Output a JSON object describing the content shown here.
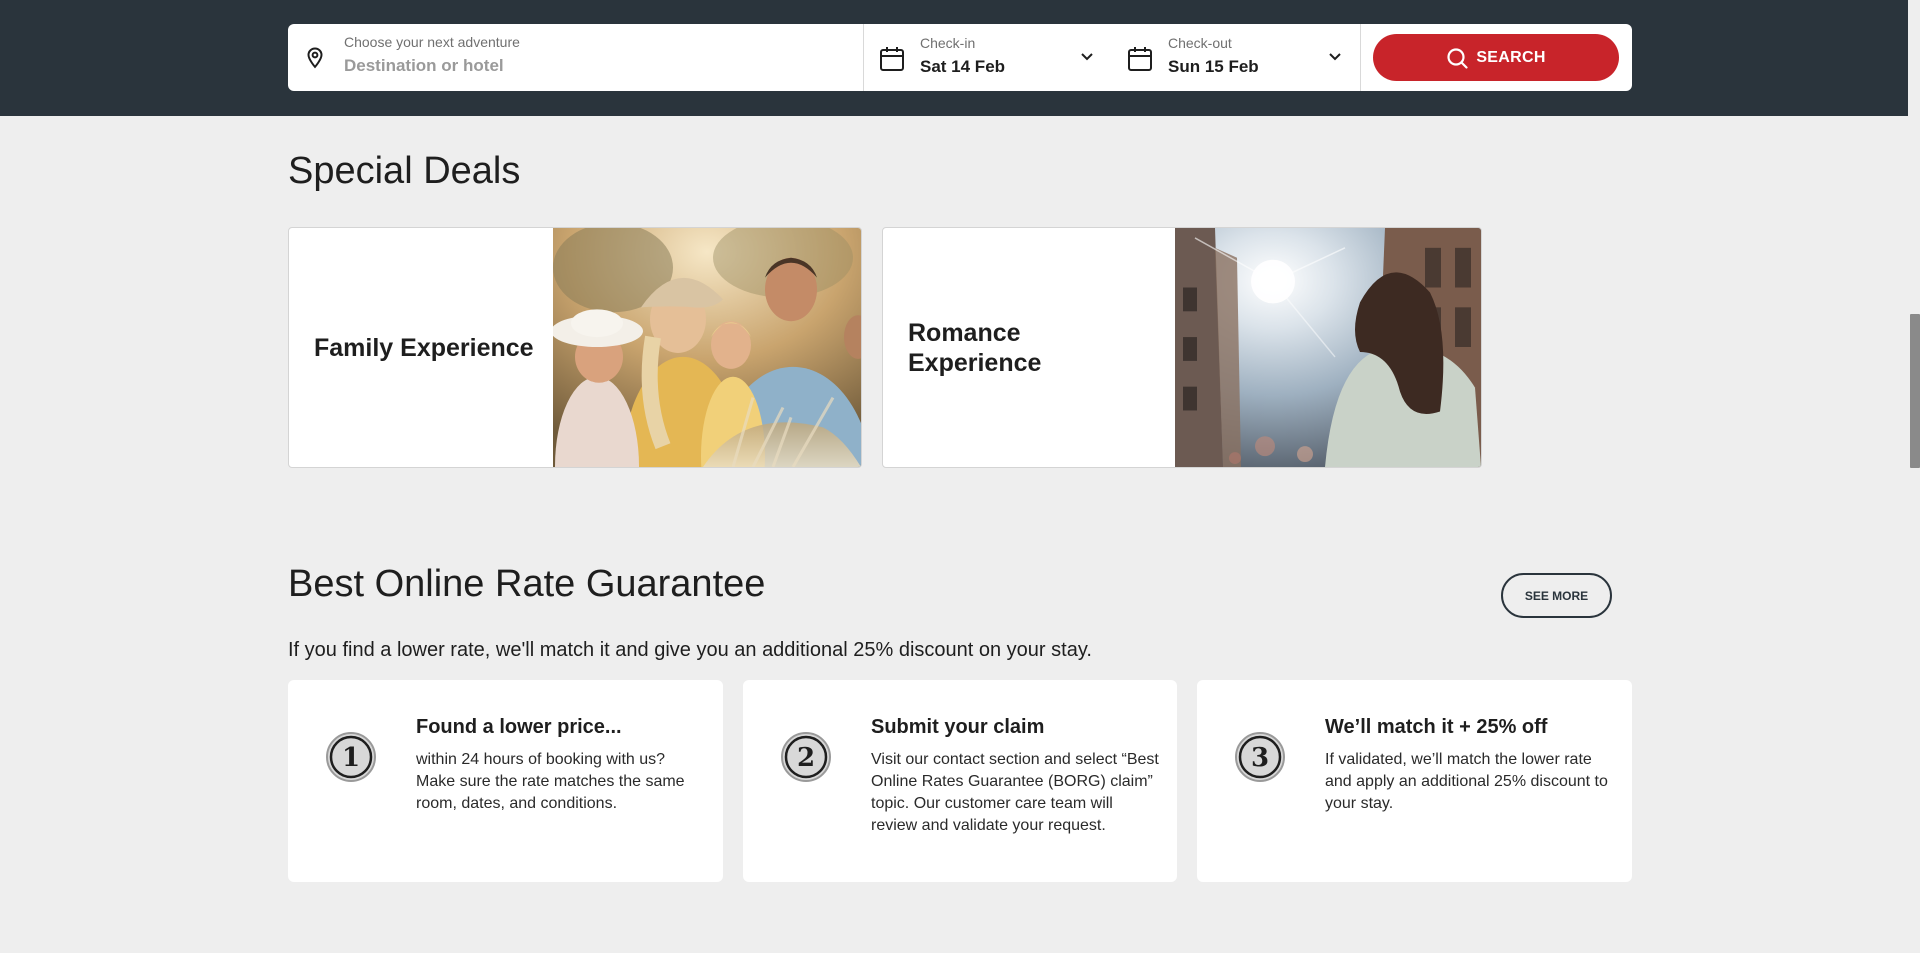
{
  "search": {
    "destination_label": "Choose your next adventure",
    "destination_placeholder": "Destination or hotel",
    "checkin_label": "Check-in",
    "checkin_value": "Sat 14 Feb",
    "checkout_label": "Check-out",
    "checkout_value": "Sun 15 Feb",
    "button_label": "SEARCH",
    "button_color": "#c8242a"
  },
  "deals": {
    "title": "Special Deals",
    "items": [
      {
        "label": "Family Experience"
      },
      {
        "label": "Romance Experience"
      }
    ]
  },
  "borg": {
    "title": "Best Online Rate Guarantee",
    "see_more_label": "SEE MORE",
    "subtitle": "If you find a lower rate, we'll match it and give you an additional 25% discount on your stay.",
    "steps": [
      {
        "number": "1",
        "title": "Found a lower price...",
        "text": "within 24 hours of booking with us? Make sure the rate matches the same room, dates, and conditions."
      },
      {
        "number": "2",
        "title": "Submit your claim",
        "text": "Visit our contact section and select “Best Online Rates Guarantee (BORG) claim” topic. Our customer care team will review and validate your request."
      },
      {
        "number": "3",
        "title": "We’ll match it + 25% off",
        "text": "If validated, we’ll match the lower rate and apply an additional 25% discount to your stay."
      }
    ]
  },
  "colors": {
    "header_bg": "#2a343c",
    "page_bg": "#eeeeee",
    "accent": "#c8242a"
  }
}
